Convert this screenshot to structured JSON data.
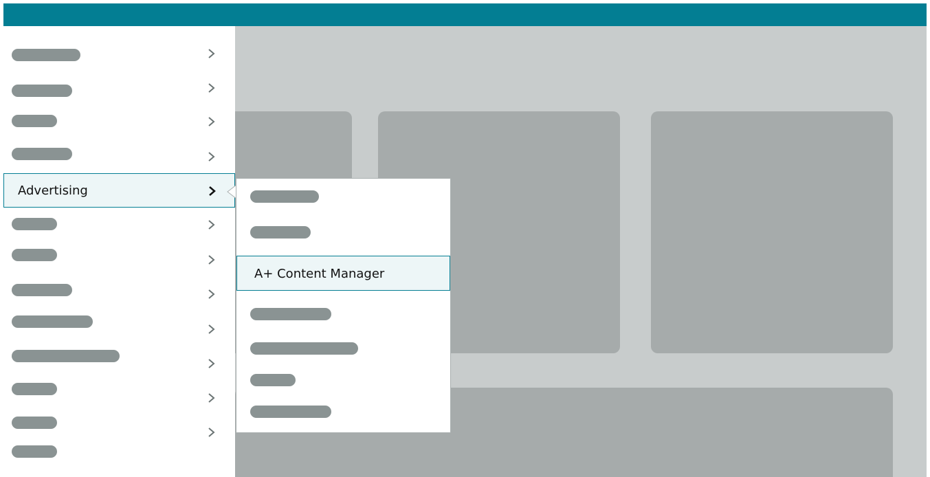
{
  "colors": {
    "header": "#037e93",
    "content_background": "#c8cccc",
    "card": "#a6abab",
    "placeholder_pill": "#8a9393",
    "active_background": "#edf6f7",
    "active_border": "#037e93"
  },
  "sidebar": {
    "active_label": "Advertising",
    "chevron_icon": "chevron-right-icon"
  },
  "flyout": {
    "active_label": "A+ Content Manager"
  }
}
